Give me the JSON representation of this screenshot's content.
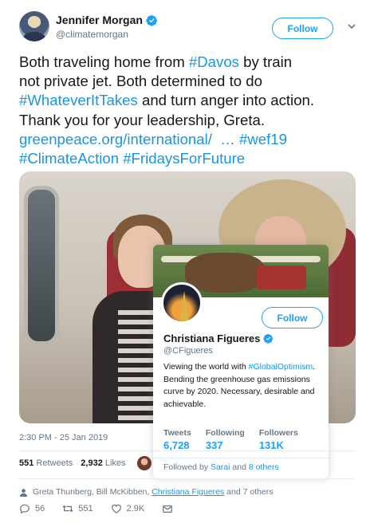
{
  "author": {
    "display_name": "Jennifer Morgan",
    "handle": "@climatemorgan",
    "follow_label": "Follow"
  },
  "tweet": {
    "line1_pre": "Both traveling home from ",
    "line1_tag": "#Davos",
    "line1_post": " by train",
    "line2": "not private jet. Both determined to do",
    "line3_tag": "#WhateverItTakes",
    "line3_post": " and turn anger into action.",
    "line4": "Thank you for your leadership, Greta.",
    "link": "greenpeace.org/international/",
    "ellipsis": "  … ",
    "tag_wef": "#wef19",
    "tag_climate": "#ClimateAction",
    "tag_fridays": "#FridaysForFuture"
  },
  "hover_card": {
    "name": "Christiana Figueres",
    "handle": "@CFigueres",
    "follow_label": "Follow",
    "bio_1": "Viewing the world with",
    "bio_tag": "#GlobalOptimism",
    "bio_2": ". Bending the greenhouse gas emissions curve by 2020. Necessary, desirable and achievable.",
    "stats": [
      {
        "label": "Tweets",
        "value": "6,728"
      },
      {
        "label": "Following",
        "value": "337"
      },
      {
        "label": "Followers",
        "value": "131K"
      }
    ],
    "followed_by_prefix": "Followed by ",
    "followed_by_user": "Sarai",
    "followed_by_and": " and ",
    "followed_by_others": "8 others"
  },
  "meta": {
    "timestamp": "2:30 PM - 25 Jan 2019",
    "retweets_count": "551",
    "retweets_label": "Retweets",
    "likes_count": "2,932",
    "likes_label": "Likes"
  },
  "tagged": {
    "names": "Greta Thunberg, Bill McKibben, ",
    "link_name": "Christiana Figueres",
    "suffix": " and 7 others"
  },
  "actions": {
    "replies": "56",
    "retweets": "551",
    "likes": "2.9K"
  },
  "colors": {
    "accent": "#1da1f2",
    "link": "#1b95e0",
    "secondary_text": "#657786"
  }
}
